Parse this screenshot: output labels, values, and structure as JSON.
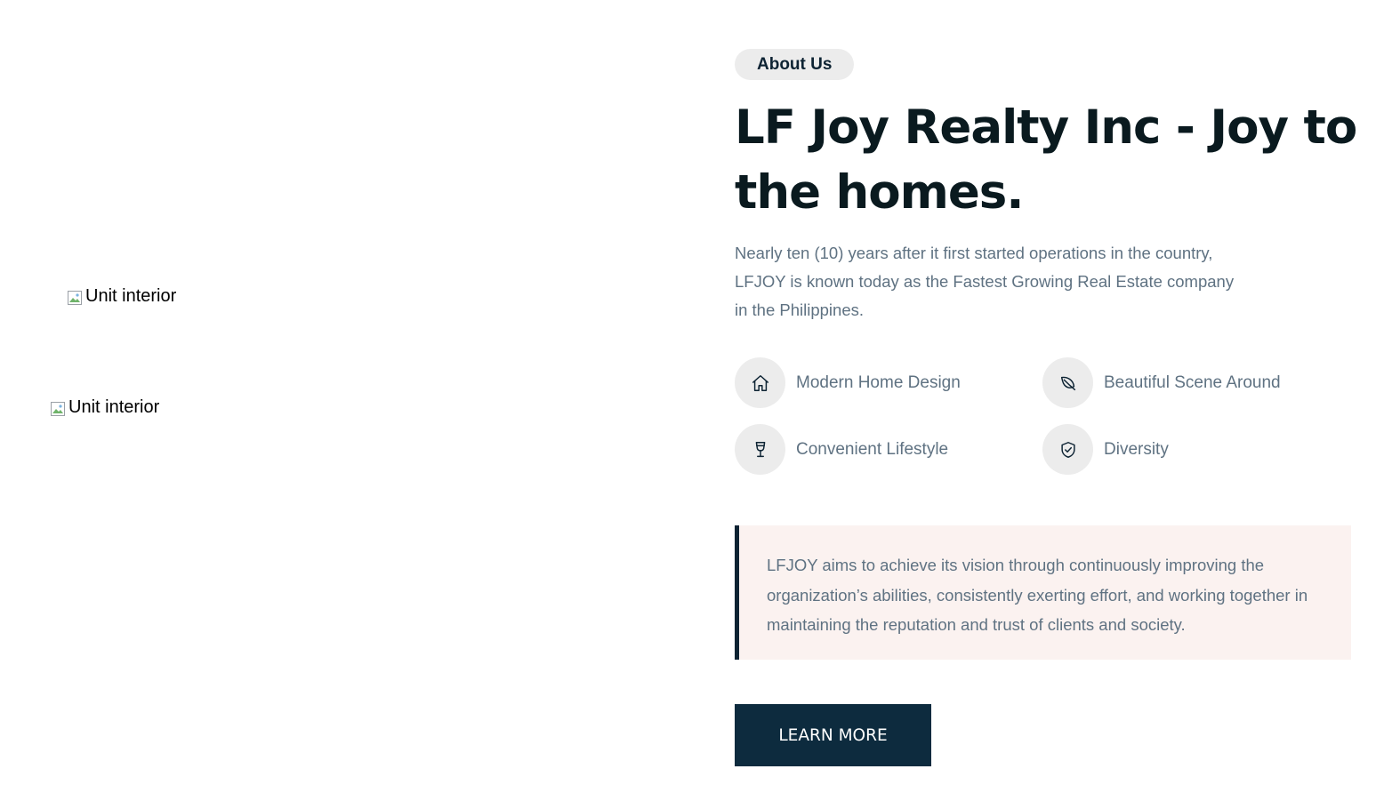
{
  "images": [
    {
      "alt": "Unit interior"
    },
    {
      "alt": "Unit interior"
    }
  ],
  "about": {
    "pill_label": "About Us",
    "title": "LF Joy Realty Inc - Joy to the homes.",
    "description": "Nearly ten (10) years after it first started operations in the country, LFJOY is known today as the Fastest Growing Real Estate company in the Philippines.",
    "features": [
      {
        "label": "Modern Home Design",
        "icon": "home-icon"
      },
      {
        "label": "Beautiful Scene Around",
        "icon": "leaf-icon"
      },
      {
        "label": "Convenient Lifestyle",
        "icon": "wine-glass-icon"
      },
      {
        "label": "Diversity",
        "icon": "shield-check-icon"
      }
    ],
    "quote": "LFJOY aims to achieve its vision through continuously improving the organization’s abilities, consistently exerting effort, and working together in maintaining the reputation and trust of clients and society.",
    "button_label": "LEARN MORE"
  },
  "colors": {
    "navy": "#0d2b3e",
    "heading": "#0a1a1f",
    "body_text": "#5f7282",
    "pill_bg": "#ececec",
    "quote_bg": "#fbf2f0"
  }
}
